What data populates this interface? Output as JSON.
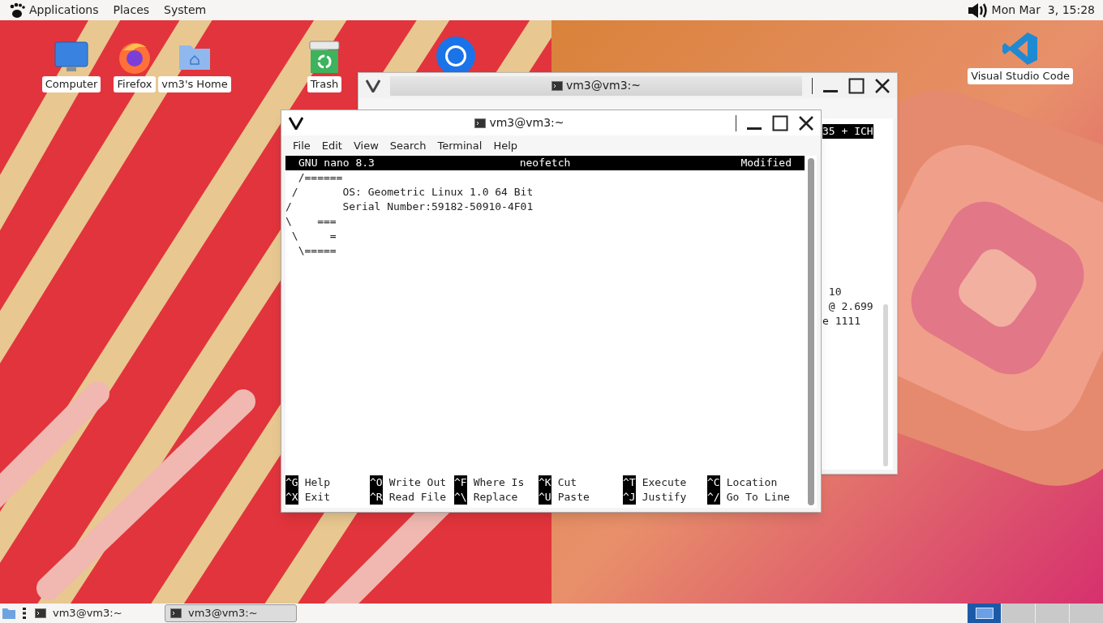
{
  "top_panel": {
    "menus": [
      "Applications",
      "Places",
      "System"
    ],
    "clock": "Mon Mar  3, 15:28"
  },
  "desktop_icons": [
    {
      "kind": "computer",
      "label": "Computer"
    },
    {
      "kind": "firefox",
      "label": "Firefox"
    },
    {
      "kind": "home",
      "label": "vm3's Home"
    },
    {
      "kind": "trash",
      "label": "Trash"
    },
    {
      "kind": "chrome"
    },
    {
      "kind": "vscode",
      "label": "Visual Studio Code"
    }
  ],
  "windows": [
    {
      "title": "vm3@vm3:~",
      "active": false,
      "upper_lines": [
        {
          "text": "35 + ICH",
          "highlighted": true
        }
      ],
      "lower_lines": [
        {
          "text": " 10",
          "highlighted": false
        },
        {
          "text": " @ 2.699",
          "highlighted": false
        },
        {
          "text": "e 1111",
          "highlighted": false
        }
      ]
    },
    {
      "title": "vm3@vm3:~",
      "active": true,
      "menu": [
        "File",
        "Edit",
        "View",
        "Search",
        "Terminal",
        "Help"
      ],
      "nano": {
        "header": {
          "left": "GNU nano 8.3",
          "center": "neofetch",
          "right": "Modified"
        },
        "lines": [
          "  /======",
          " /       OS: Geometric Linux 1.0 64 Bit",
          "/        Serial Number:59182-50910-4F01",
          "\\    ===",
          " \\     =",
          "  \\====="
        ],
        "shortcuts": [
          [
            {
              "key": "^G",
              "label": "Help"
            },
            {
              "key": "^O",
              "label": "Write Out"
            },
            {
              "key": "^F",
              "label": "Where Is"
            },
            {
              "key": "^K",
              "label": "Cut"
            },
            {
              "key": "^T",
              "label": "Execute"
            },
            {
              "key": "^C",
              "label": "Location"
            }
          ],
          [
            {
              "key": "^X",
              "label": "Exit"
            },
            {
              "key": "^R",
              "label": "Read File"
            },
            {
              "key": "^\\",
              "label": "Replace"
            },
            {
              "key": "^U",
              "label": "Paste"
            },
            {
              "key": "^J",
              "label": "Justify"
            },
            {
              "key": "^/",
              "label": "Go To Line"
            }
          ]
        ]
      }
    }
  ],
  "taskbar": {
    "tasks": [
      {
        "label": "vm3@vm3:~",
        "selected": false
      },
      {
        "label": "vm3@vm3:~",
        "selected": true
      }
    ],
    "workspaces": [
      {
        "selected": true
      },
      {
        "selected": false
      },
      {
        "selected": false
      },
      {
        "selected": false
      }
    ]
  }
}
